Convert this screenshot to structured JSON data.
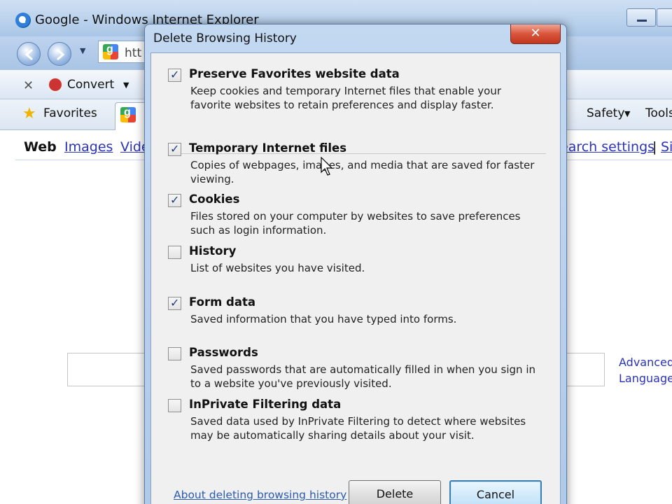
{
  "browser": {
    "window_title": "Google - Windows Internet Explorer",
    "address_fragment": "htt",
    "commandbar": {
      "convert_label": "Convert"
    },
    "favbar": {
      "favorites_label": "Favorites",
      "safety_label": "Safety",
      "tools_label": "Tools"
    },
    "google_nav": {
      "web": "Web",
      "images": "Images",
      "videos_fragment": "Vide",
      "search_settings_fragment": "earch settings",
      "separator": "|",
      "signin_fragment": "Si"
    },
    "side_links": {
      "advanced": "Advanced",
      "language": "Language"
    }
  },
  "dialog": {
    "title": "Delete Browsing History",
    "close_glyph": "✕",
    "options": [
      {
        "label": "Preserve Favorites website data",
        "checked": true,
        "description": "Keep cookies and temporary Internet files that enable your favorite websites to retain preferences and display faster."
      },
      {
        "label": "Temporary Internet files",
        "checked": true,
        "description": "Copies of webpages, images, and media that are saved for faster viewing."
      },
      {
        "label": "Cookies",
        "checked": true,
        "description": "Files stored on your computer by websites to save preferences such as login information."
      },
      {
        "label": "History",
        "checked": false,
        "description": "List of websites you have visited."
      },
      {
        "label": "Form data",
        "checked": true,
        "description": "Saved information that you have typed into forms."
      },
      {
        "label": "Passwords",
        "checked": false,
        "description": "Saved passwords that are automatically filled in when you sign in to a website you've previously visited."
      },
      {
        "label": "InPrivate Filtering data",
        "checked": false,
        "description": "Saved data used by InPrivate Filtering to detect where websites may be automatically sharing details about your visit."
      }
    ],
    "about_link": "About deleting browsing history",
    "delete_button": "Delete",
    "cancel_button": "Cancel"
  }
}
